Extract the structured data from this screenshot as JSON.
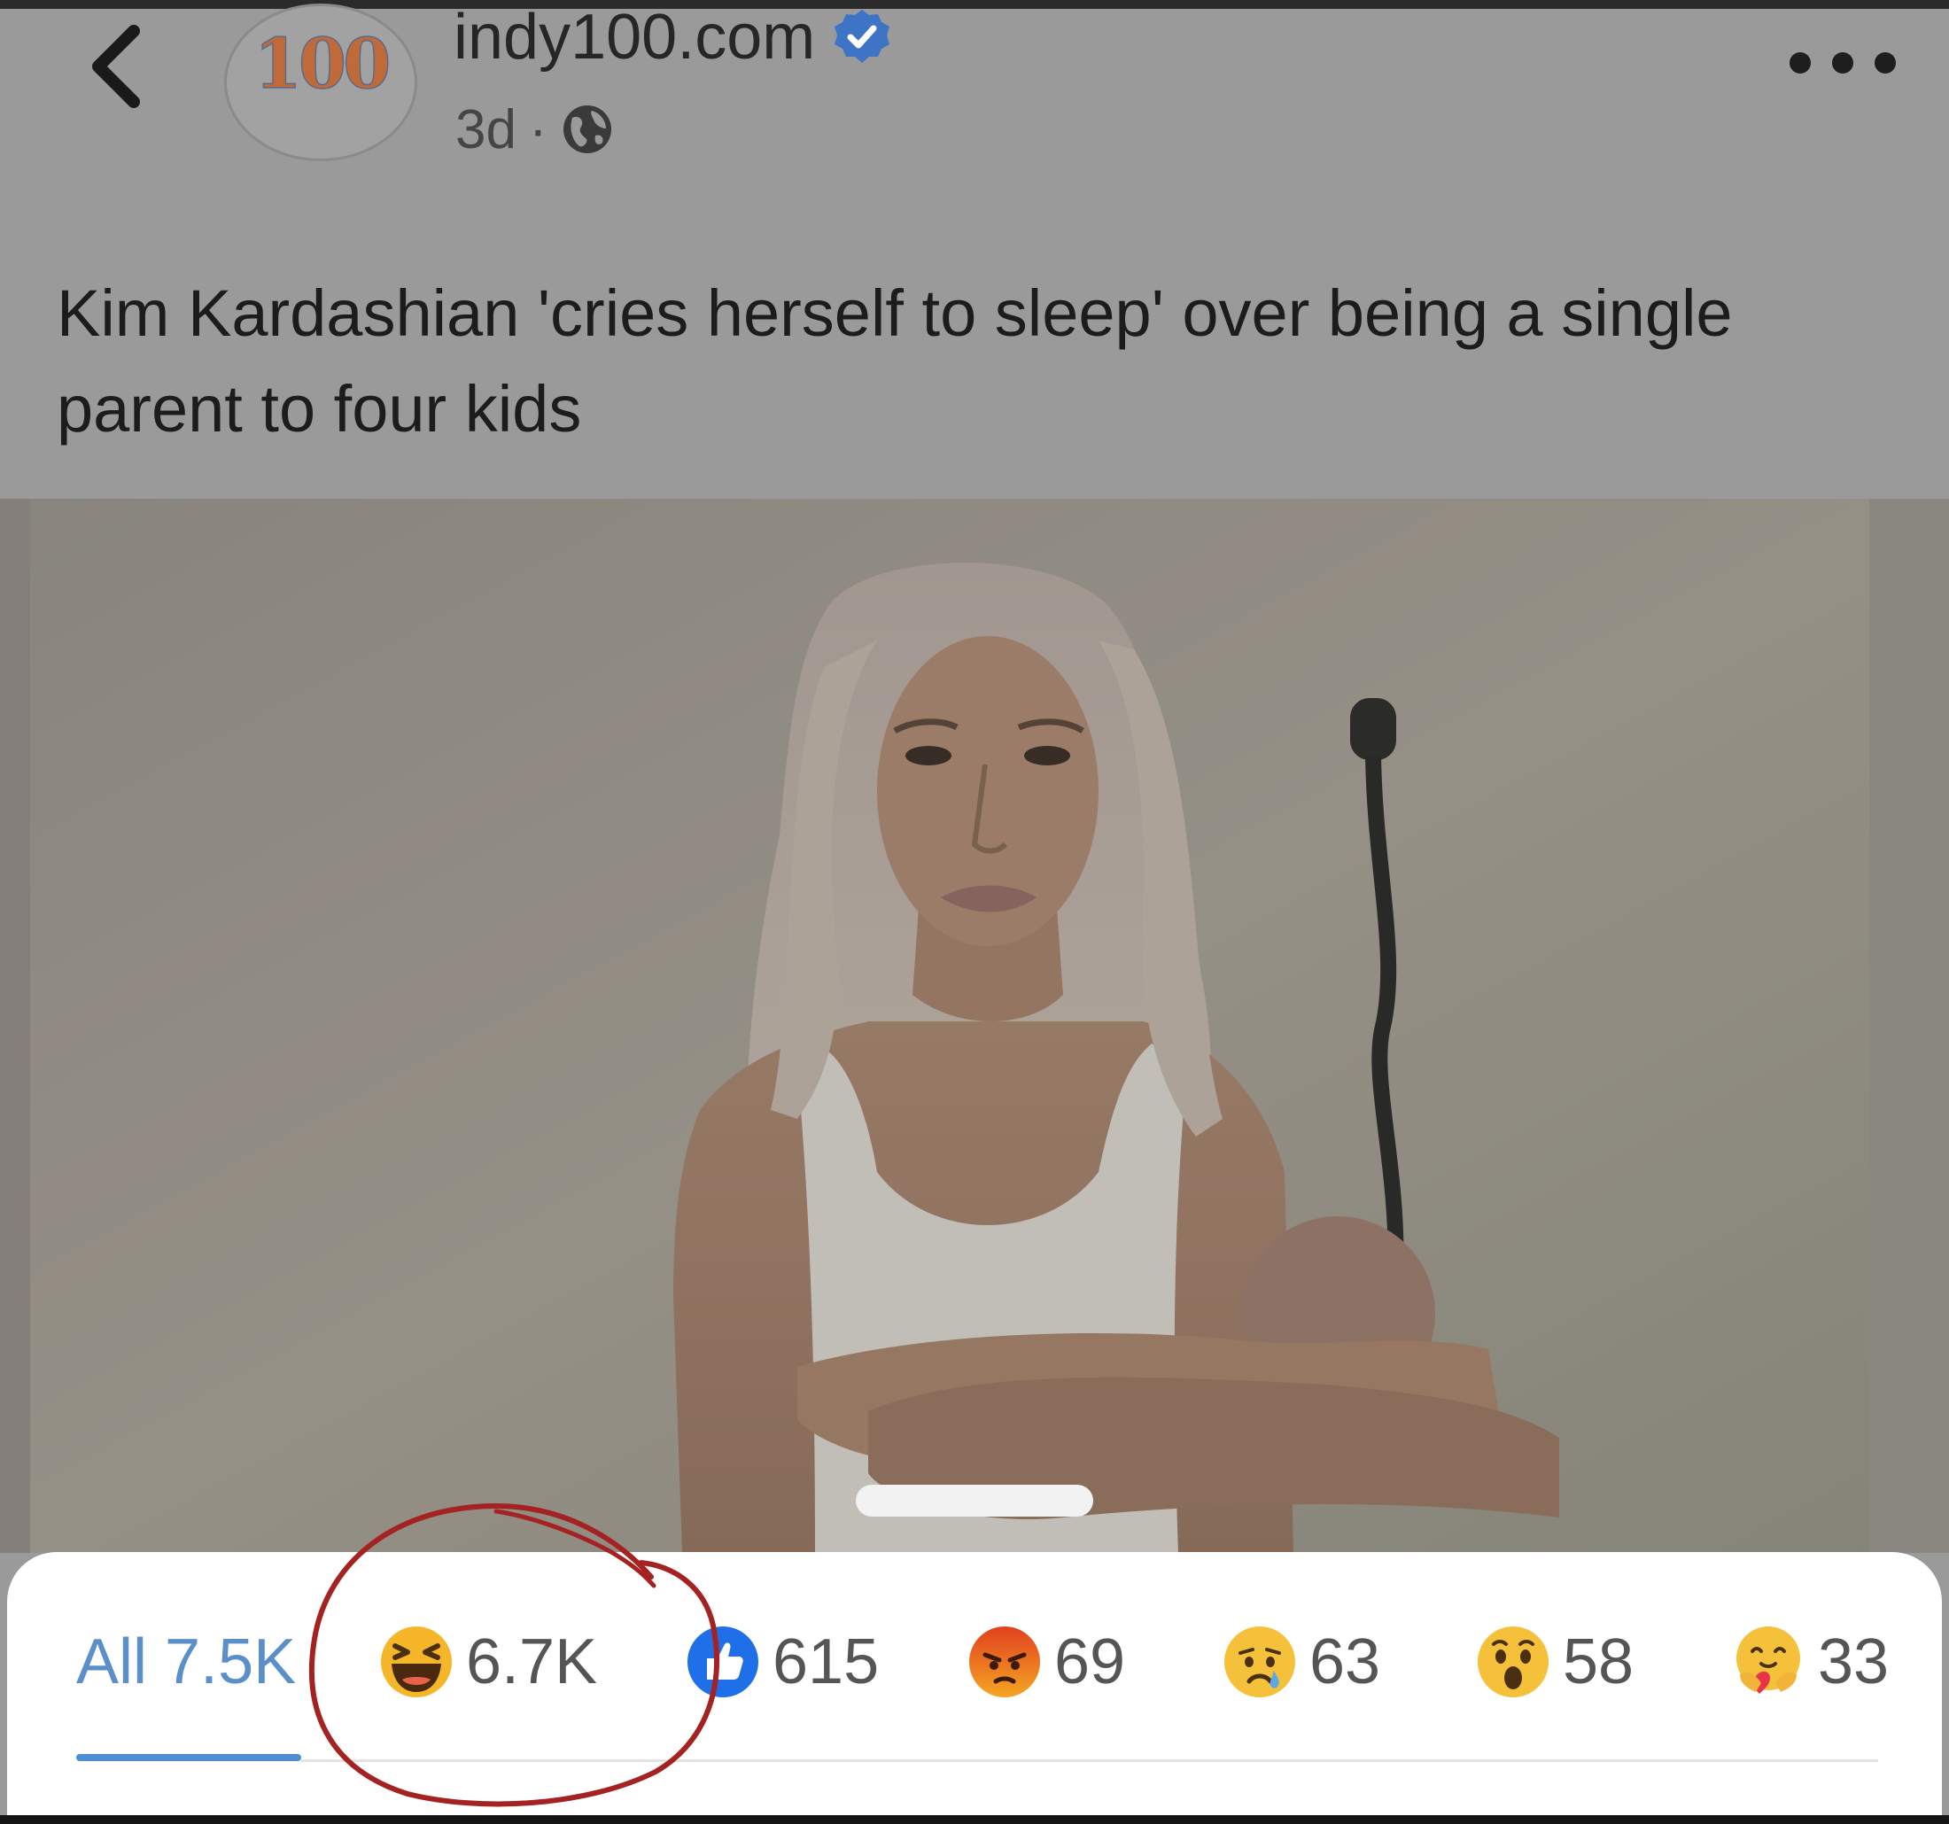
{
  "post": {
    "page_name": "indy100.com",
    "avatar_text": "100",
    "timestamp": "3d",
    "separator": "·",
    "audience_icon": "globe-icon",
    "verified_icon": "verified-badge-icon",
    "headline": "Kim Kardashian 'cries herself to sleep' over being a single parent to four kids"
  },
  "header": {
    "back_icon": "chevron-left-icon",
    "more_icon": "more-dots-icon"
  },
  "photo": {
    "alt": "photo of a woman with platinum hair in a white tank top, hugging her knees"
  },
  "reactions": {
    "all": {
      "label": "All",
      "count": "7.5K"
    },
    "tabs": [
      {
        "name": "haha",
        "icon": "laughing-emoji-icon",
        "count": "6.7K"
      },
      {
        "name": "like",
        "icon": "thumbs-up-icon",
        "count": "615"
      },
      {
        "name": "angry",
        "icon": "angry-emoji-icon",
        "count": "69"
      },
      {
        "name": "sad",
        "icon": "crying-emoji-icon",
        "count": "63"
      },
      {
        "name": "wow",
        "icon": "surprised-emoji-icon",
        "count": "58"
      },
      {
        "name": "care",
        "icon": "care-emoji-icon",
        "count": "33"
      }
    ],
    "selected": "all"
  },
  "colors": {
    "accent": "#4d8fd2",
    "annotation": "#a42222",
    "overlay": "#9a9a9a"
  }
}
